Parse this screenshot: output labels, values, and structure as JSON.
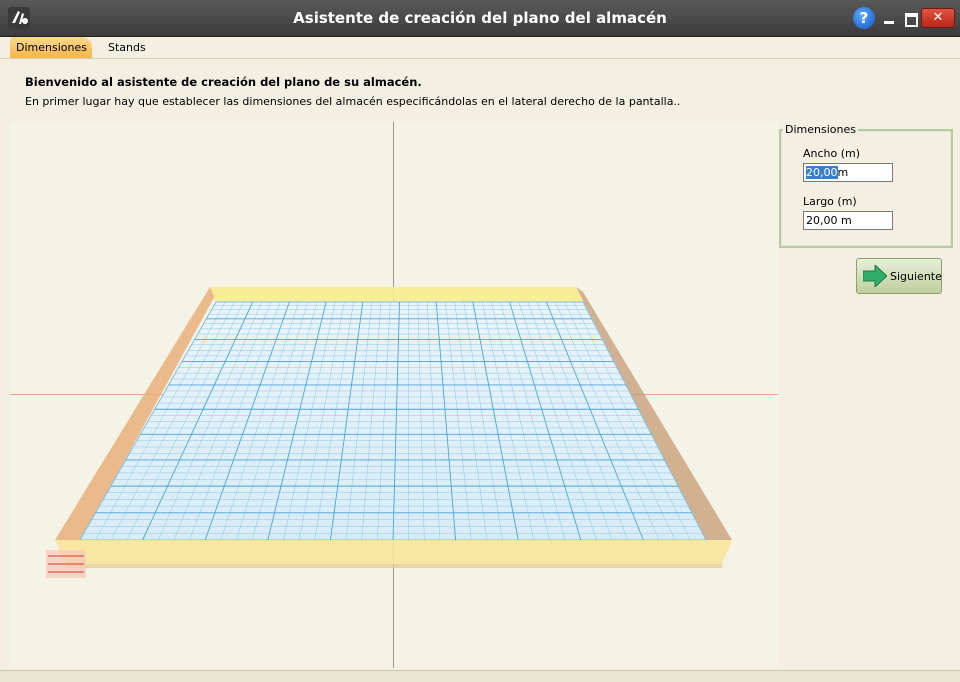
{
  "window": {
    "title": "Asistente de creación del plano del almacén"
  },
  "titlebar": {
    "help_label": "?",
    "close_label": "✕"
  },
  "tabs": [
    {
      "label": "Dimensiones"
    },
    {
      "label": "Stands"
    }
  ],
  "intro": {
    "heading": "Bienvenido al asistente de creación del plano de su almacén.",
    "text": "En primer lugar hay que establecer las dimensiones del almacén especificándolas en el lateral derecho de la pantalla.."
  },
  "dimensions": {
    "group_label": "Dimensiones",
    "width": {
      "label": "Ancho (m)",
      "value": "20,00",
      "unit": "m"
    },
    "length": {
      "label": "Largo (m)",
      "value": "20,00 m"
    }
  },
  "next_button": {
    "label": "Siguiente"
  },
  "colors": {
    "tab_active": "#f4b64a",
    "grid_line": "#6fb4e0",
    "wall": "#f2d98a",
    "accent_selection": "#3a7fd6"
  }
}
